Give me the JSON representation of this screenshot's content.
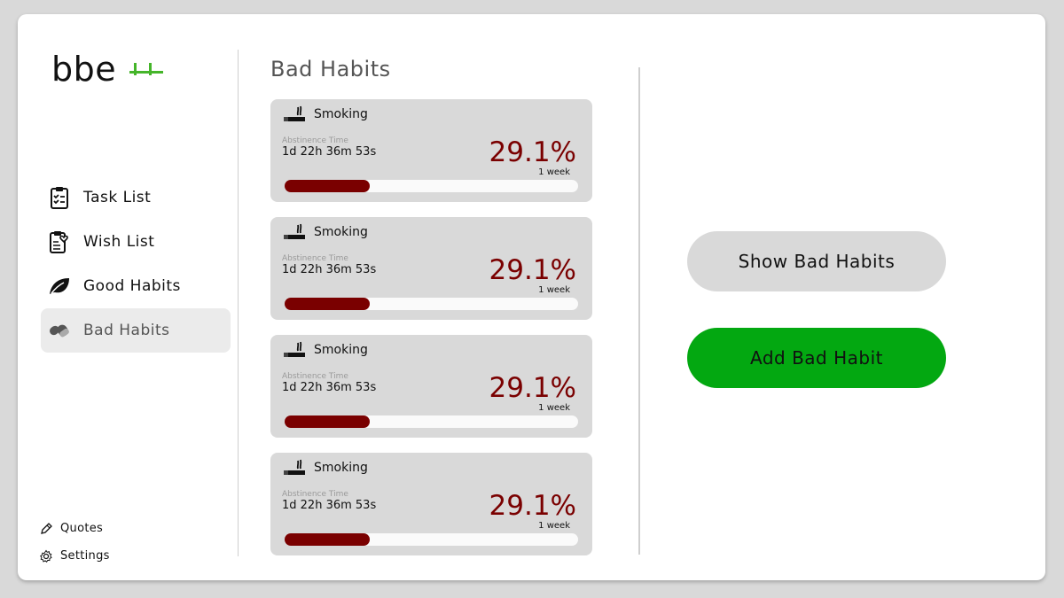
{
  "app": {
    "logo_text": "bbe",
    "logo_accent_color": "#45b52a"
  },
  "sidebar": {
    "items": [
      {
        "label": "Task List",
        "icon": "clipboard-check-icon",
        "active": false
      },
      {
        "label": "Wish List",
        "icon": "clipboard-heart-icon",
        "active": false
      },
      {
        "label": "Good Habits",
        "icon": "leaf-icon",
        "active": false
      },
      {
        "label": "Bad Habits",
        "icon": "pills-icon",
        "active": true
      }
    ],
    "bottom": [
      {
        "label": "Quotes",
        "icon": "pencil-icon"
      },
      {
        "label": "Settings",
        "icon": "gear-icon"
      }
    ]
  },
  "main": {
    "title": "Bad Habits",
    "cards": [
      {
        "name": "Smoking",
        "icon": "cigarette-icon",
        "abstinence_label": "Abstinence Time",
        "time": "1d 22h 36m 53s",
        "percent": "29.1%",
        "period": "1 week",
        "progress": 0.291
      },
      {
        "name": "Smoking",
        "icon": "cigarette-icon",
        "abstinence_label": "Abstinence Time",
        "time": "1d 22h 36m 53s",
        "percent": "29.1%",
        "period": "1 week",
        "progress": 0.291
      },
      {
        "name": "Smoking",
        "icon": "cigarette-icon",
        "abstinence_label": "Abstinence Time",
        "time": "1d 22h 36m 53s",
        "percent": "29.1%",
        "period": "1 week",
        "progress": 0.291
      },
      {
        "name": "Smoking",
        "icon": "cigarette-icon",
        "abstinence_label": "Abstinence Time",
        "time": "1d 22h 36m 53s",
        "percent": "29.1%",
        "period": "1 week",
        "progress": 0.291
      }
    ]
  },
  "actions": {
    "show_label": "Show Bad Habits",
    "add_label": "Add Bad Habit",
    "add_color": "#03a811",
    "progress_color": "#7a0000"
  }
}
